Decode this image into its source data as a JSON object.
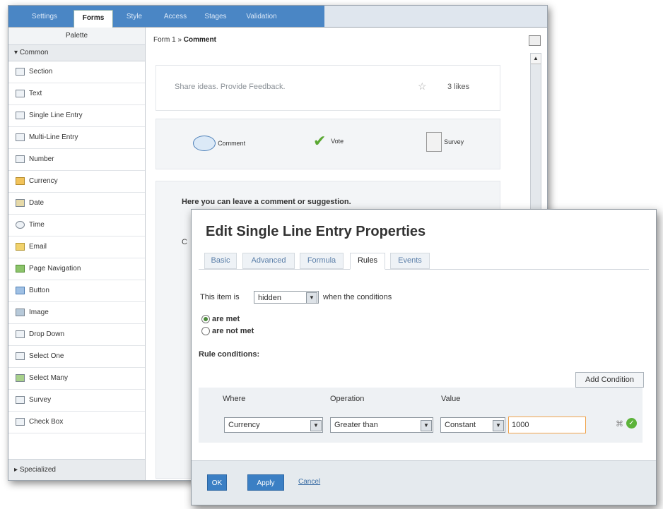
{
  "top_tabs": [
    "Settings",
    "Forms",
    "Style",
    "Access",
    "Stages",
    "Validation"
  ],
  "palette": {
    "header": "Palette",
    "group_common": "Common",
    "items": [
      {
        "label": "Section",
        "icon": "section-icon"
      },
      {
        "label": "Text",
        "icon": "text-icon"
      },
      {
        "label": "Single Line Entry",
        "icon": "single-line-entry-icon"
      },
      {
        "label": "Multi-Line Entry",
        "icon": "multi-line-entry-icon"
      },
      {
        "label": "Number",
        "icon": "number-icon"
      },
      {
        "label": "Currency",
        "icon": "currency-icon"
      },
      {
        "label": "Date",
        "icon": "date-icon"
      },
      {
        "label": "Time",
        "icon": "time-icon"
      },
      {
        "label": "Email",
        "icon": "email-icon"
      },
      {
        "label": "Page Navigation",
        "icon": "page-navigation-icon"
      },
      {
        "label": "Button",
        "icon": "button-icon"
      },
      {
        "label": "Image",
        "icon": "image-icon"
      },
      {
        "label": "Drop Down",
        "icon": "drop-down-icon"
      },
      {
        "label": "Select One",
        "icon": "select-one-icon"
      },
      {
        "label": "Select Many",
        "icon": "select-many-icon"
      },
      {
        "label": "Survey",
        "icon": "survey-icon"
      },
      {
        "label": "Check Box",
        "icon": "check-box-icon"
      }
    ],
    "group_specialized": "Specialized"
  },
  "breadcrumb": {
    "form": "Form 1",
    "separator": "»",
    "current": "Comment"
  },
  "canvas": {
    "share_text": "Share ideas. Provide Feedback.",
    "likes": "3 likes",
    "actions": [
      "Comment",
      "Vote",
      "Survey"
    ],
    "comment_heading": "Here you can leave a comment or suggestion.",
    "partial_label": "C"
  },
  "dialog": {
    "title": "Edit Single Line Entry Properties",
    "tabs": [
      "Basic",
      "Advanced",
      "Formula",
      "Rules",
      "Events"
    ],
    "active_tab": "Rules",
    "item_is_prefix": "This item is",
    "item_is_value": "hidden",
    "item_is_suffix": "when the conditions",
    "radio_met": "are met",
    "radio_not_met": "are not met",
    "rule_conditions_label": "Rule conditions:",
    "add_condition": "Add Condition",
    "columns": {
      "where": "Where",
      "operation": "Operation",
      "value": "Value"
    },
    "row": {
      "where": "Currency",
      "operation": "Greater than",
      "value_type": "Constant",
      "value": "1000"
    },
    "ok": "OK",
    "apply": "Apply",
    "cancel": "Cancel"
  },
  "colors": {
    "accent": "#3b7fc4",
    "tab_band": "#4a86c5",
    "link": "#5a7ea8"
  }
}
